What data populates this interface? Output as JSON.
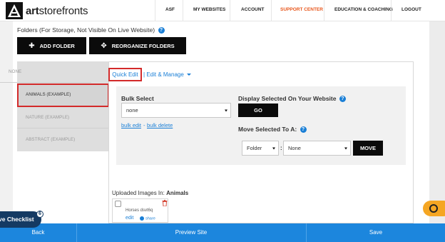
{
  "brand": {
    "name_bold": "art",
    "name_rest": "storefronts"
  },
  "nav": {
    "items": [
      "ASF",
      "MY WEBSITES",
      "ACCOUNT",
      "SUPPORT CENTER",
      "EDUCATION & COACHING",
      "LOGOUT"
    ],
    "active": "SUPPORT CENTER",
    "active_color": "#e8561b"
  },
  "folders": {
    "title": "Folders (For Storage, Not Visible On Live Website)",
    "help_glyph": "?",
    "add_label": "ADD FOLDER",
    "reorganize_label": "REORGANIZE FOLDERS",
    "list": [
      "NONE",
      "ANIMALS (EXAMPLE)",
      "NATURE (EXAMPLE)",
      "ABSTRACT (EXAMPLE)"
    ],
    "selected": "ANIMALS (EXAMPLE)"
  },
  "tabs": {
    "quick_edit": "Quick Edit",
    "separator": "|",
    "edit_manage": "Edit & Manage"
  },
  "bulk": {
    "title": "Bulk Select",
    "select_value": "none",
    "edit_link": "bulk edit",
    "dash": "-",
    "delete_link": "bulk delete"
  },
  "display": {
    "title": "Display Selected On Your Website",
    "go_label": "GO"
  },
  "move": {
    "title": "Move Selected To A:",
    "type_value": "Folder",
    "colon": ":",
    "target_value": "None",
    "button": "MOVE"
  },
  "uploaded": {
    "prefix": "Uploaded Images In:",
    "folder": "Animals",
    "image_name": "Horses dsvt6q",
    "edit_link": "edit",
    "share_link": "share"
  },
  "bottom": {
    "back": "Back",
    "preview": "Preview Site",
    "save": "Save"
  },
  "checklist": {
    "label": "ve Checklist",
    "badge": "6"
  },
  "colors": {
    "accent_blue": "#1c86dd",
    "highlight_red": "#d32a2a",
    "dark_button": "#0b0b0b",
    "chat_orange": "#f5a623"
  }
}
